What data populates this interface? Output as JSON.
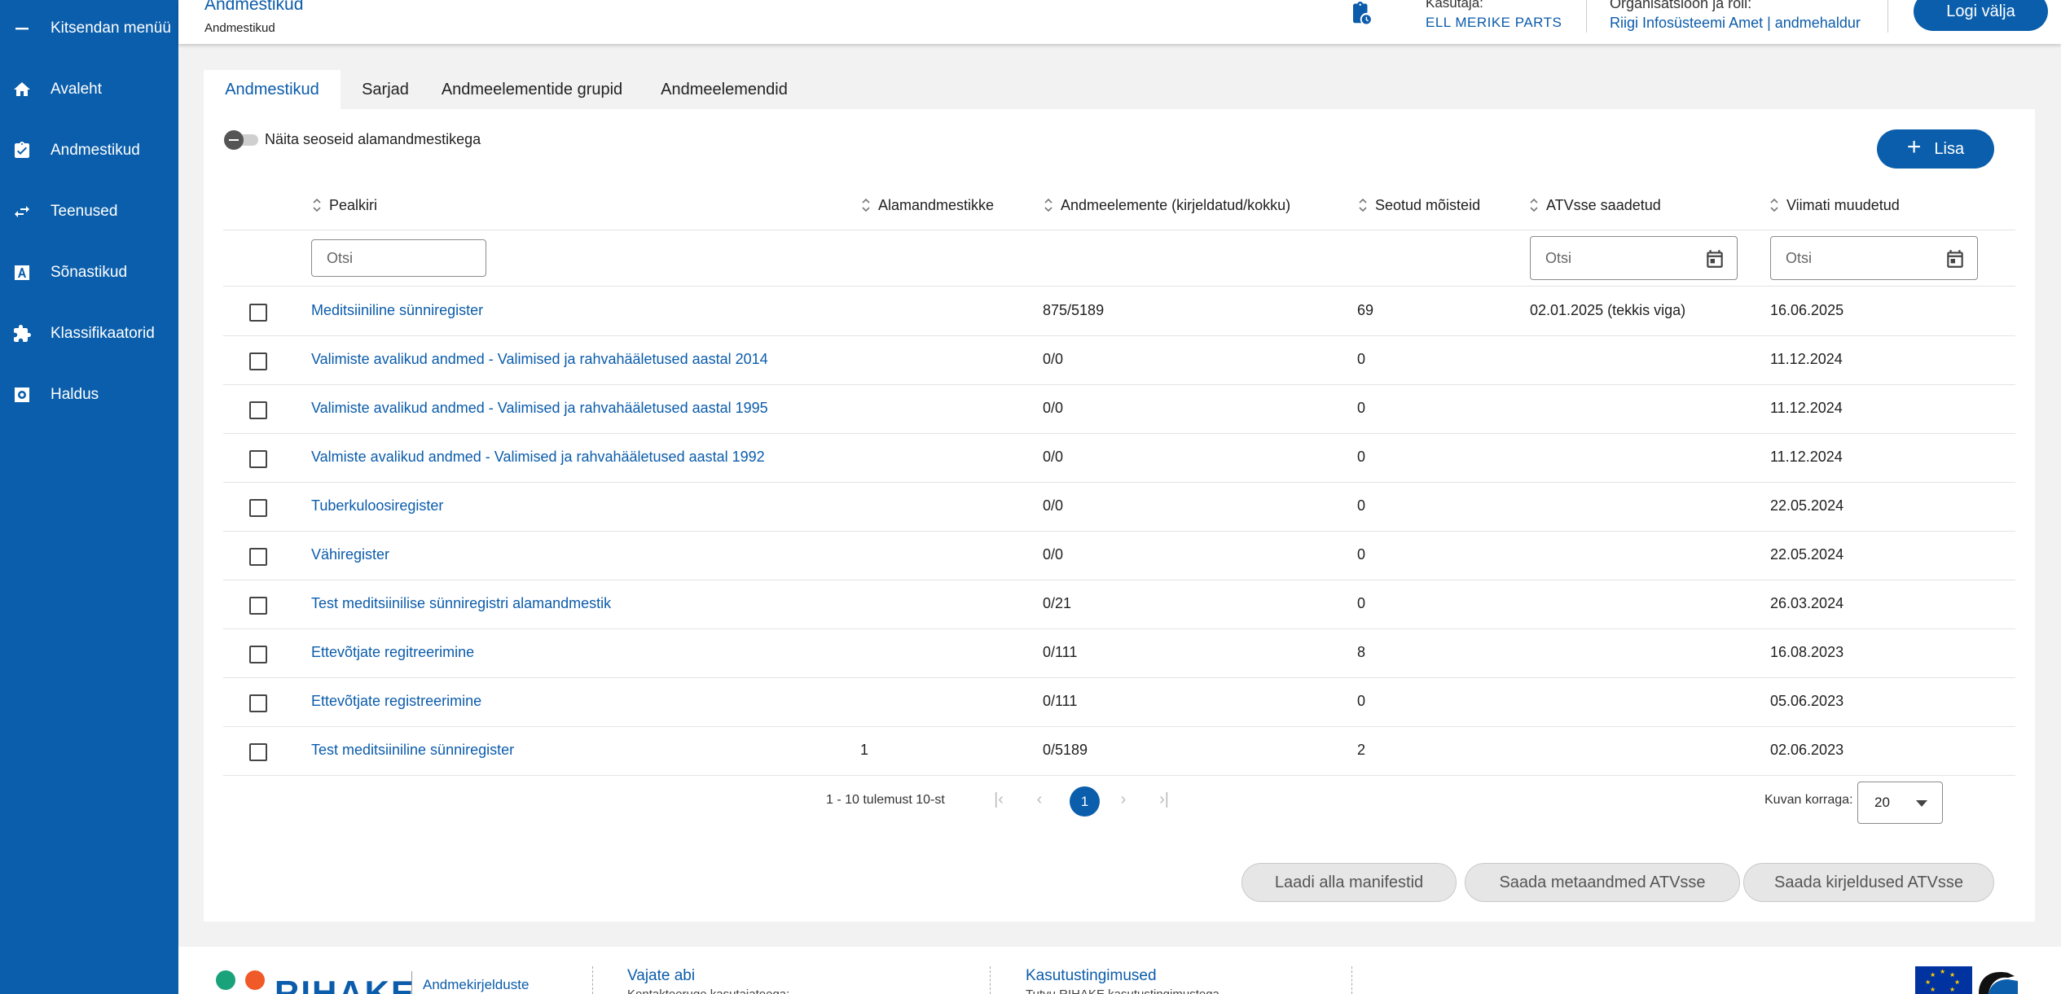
{
  "sidebar": {
    "items": [
      {
        "icon": "minus-icon",
        "label": "Kitsendan menüü"
      },
      {
        "icon": "home-icon",
        "label": "Avaleht"
      },
      {
        "icon": "clipboard-check-icon",
        "label": "Andmestikud"
      },
      {
        "icon": "swap-arrows-icon",
        "label": "Teenused"
      },
      {
        "icon": "letter-a-icon",
        "label": "Sõnastikud"
      },
      {
        "icon": "puzzle-icon",
        "label": "Klassifikaatorid"
      },
      {
        "icon": "gear-icon",
        "label": "Haldus"
      }
    ]
  },
  "header": {
    "title": "Andmestikud",
    "breadcrumb": "Andmestikud",
    "user_label": "Kasutaja:",
    "user_value": "ELL MERIKE PARTS",
    "org_label": "Organisatsioon ja roll:",
    "org_value": "Riigi Infosüsteemi Amet | andmehaldur",
    "logout": "Logi välja"
  },
  "tabs": [
    "Andmestikud",
    "Sarjad",
    "Andmeelementide grupid",
    "Andmeelemendid"
  ],
  "toggle_label": "Näita seoseid alamandmestikega",
  "add_button": "Lisa",
  "table": {
    "columns": [
      "Pealkiri",
      "Alamandmestikke",
      "Andmeelemente (kirjeldatud/kokku)",
      "Seotud mõisteid",
      "ATVsse saadetud",
      "Viimati muudetud"
    ],
    "search_placeholder": "Otsi",
    "rows": [
      {
        "title": "Meditsiiniline sünniregister",
        "sub": "",
        "elements": "875/5189",
        "concepts": "69",
        "atv": "02.01.2025 (tekkis viga)",
        "modified": "16.06.2025"
      },
      {
        "title": "Valimiste avalikud andmed - Valimised ja rahvahääletused aastal 2014",
        "sub": "",
        "elements": "0/0",
        "concepts": "0",
        "atv": "",
        "modified": "11.12.2024"
      },
      {
        "title": "Valimiste avalikud andmed - Valimised ja rahvahääletused aastal 1995",
        "sub": "",
        "elements": "0/0",
        "concepts": "0",
        "atv": "",
        "modified": "11.12.2024"
      },
      {
        "title": "Valmiste avalikud andmed - Valimised ja rahvahääletused aastal 1992",
        "sub": "",
        "elements": "0/0",
        "concepts": "0",
        "atv": "",
        "modified": "11.12.2024"
      },
      {
        "title": "Tuberkuloosiregister",
        "sub": "",
        "elements": "0/0",
        "concepts": "0",
        "atv": "",
        "modified": "22.05.2024"
      },
      {
        "title": "Vähiregister",
        "sub": "",
        "elements": "0/0",
        "concepts": "0",
        "atv": "",
        "modified": "22.05.2024"
      },
      {
        "title": "Test meditsiinilise sünniregistri alamandmestik",
        "sub": "",
        "elements": "0/21",
        "concepts": "0",
        "atv": "",
        "modified": "26.03.2024"
      },
      {
        "title": "Ettevõtjate regitreerimine",
        "sub": "",
        "elements": "0/111",
        "concepts": "8",
        "atv": "",
        "modified": "16.08.2023"
      },
      {
        "title": "Ettevõtjate registreerimine",
        "sub": "",
        "elements": "0/111",
        "concepts": "0",
        "atv": "",
        "modified": "05.06.2023"
      },
      {
        "title": "Test meditsiiniline sünniregister",
        "sub": "1",
        "elements": "0/5189",
        "concepts": "2",
        "atv": "",
        "modified": "02.06.2023"
      }
    ]
  },
  "pagination": {
    "info": "1 - 10 tulemust 10-st",
    "current_page": "1",
    "page_size_label": "Kuvan korraga:",
    "page_size": "20"
  },
  "actions": [
    "Laadi alla manifestid",
    "Saada metaandmed ATVsse",
    "Saada kirjeldused ATVsse"
  ],
  "footer": {
    "logo": "RIHAKE",
    "tagline": "Andmekirjelduste",
    "help_title": "Vajate abi",
    "help_text": "Kontakteeruge kasutajatoega:",
    "terms_title": "Kasutustingimused",
    "terms_text": "Tutvu RIHAKE kasutustingimustega",
    "dot_colors": [
      "#1aa37a",
      "#f05a28"
    ]
  },
  "colors": {
    "primary": "#0a5eab",
    "link": "#0b5cab"
  }
}
